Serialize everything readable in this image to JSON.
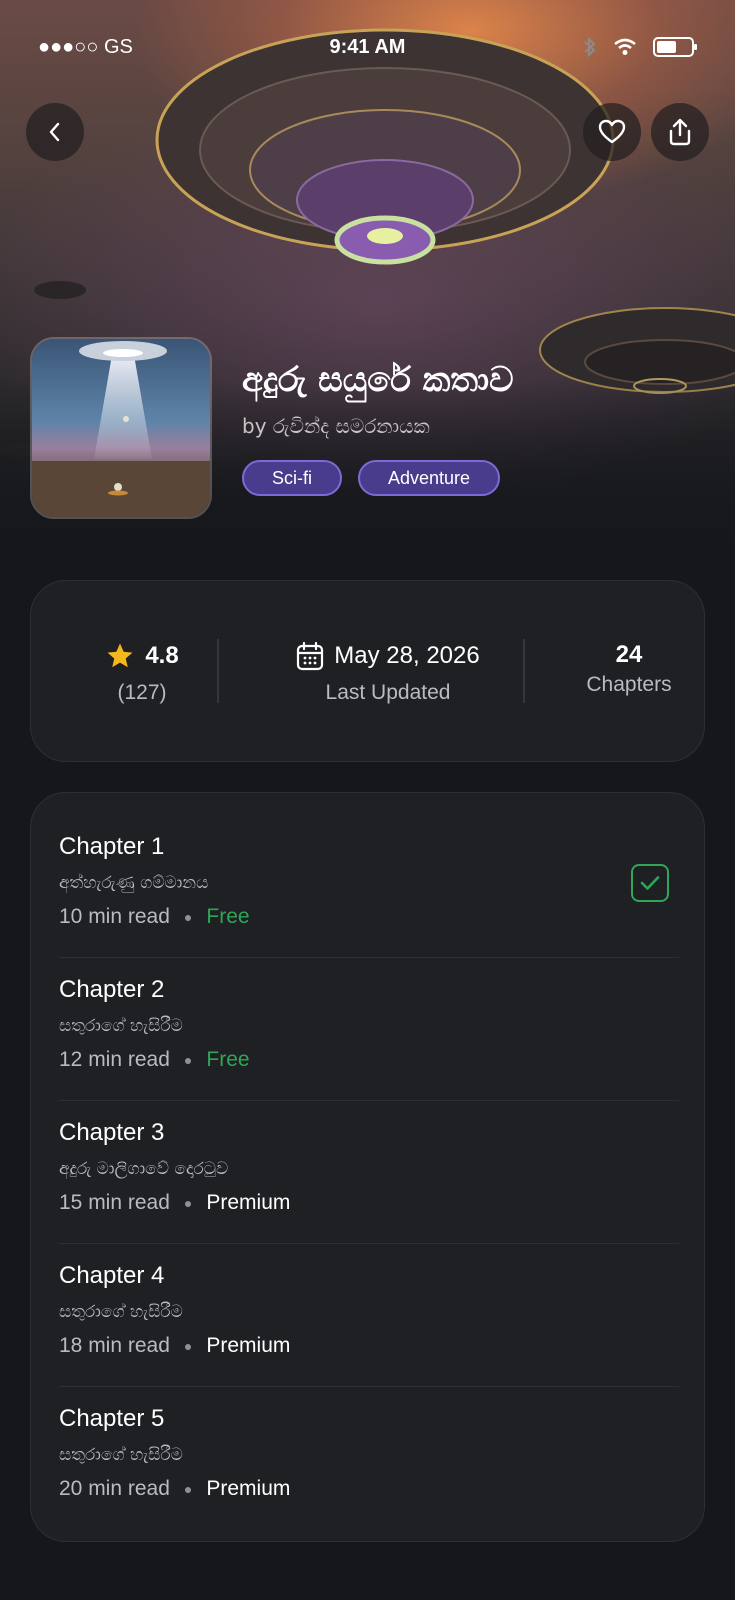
{
  "status": {
    "carrier": "●●●○○ GS",
    "time": "9:41 AM"
  },
  "book": {
    "title": "අදුරු සයුරේ කතාව",
    "author": "by රුවින්ද සමරනායක",
    "tags": [
      "Sci-fi",
      "Adventure"
    ]
  },
  "stats": {
    "rating": "4.8",
    "rating_count": "(127)",
    "updated_date": "May 28, 2026",
    "updated_label": "Last Updated",
    "chapters_count": "24",
    "chapters_label": "Chapters"
  },
  "chapters": [
    {
      "title": "Chapter 1",
      "subtitle": "අත්හැරුණු ගම්මානය",
      "read_time": "10 min read",
      "access": "Free",
      "completed": true
    },
    {
      "title": "Chapter 2",
      "subtitle": "සතුරාගේ හැසිරීම",
      "read_time": "12 min read",
      "access": "Free",
      "completed": false
    },
    {
      "title": "Chapter 3",
      "subtitle": "අදුරු මාලිගාවේ දොරටුව",
      "read_time": "15 min read",
      "access": "Premium",
      "completed": false
    },
    {
      "title": "Chapter 4",
      "subtitle": "සතුරාගේ හැසිරීම",
      "read_time": "18 min read",
      "access": "Premium",
      "completed": false
    },
    {
      "title": "Chapter 5",
      "subtitle": "සතුරාගේ හැසිරීම",
      "read_time": "20 min read",
      "access": "Premium",
      "completed": false
    }
  ],
  "colors": {
    "accent_tag": "#4a3c8c",
    "free": "#2ea655",
    "star": "#f5b81c",
    "card_bg": "#1e2024"
  },
  "icons": {
    "back": "chevron-left-icon",
    "favorite": "heart-icon",
    "share": "share-icon",
    "star": "star-icon",
    "calendar": "calendar-icon",
    "check": "check-icon"
  }
}
